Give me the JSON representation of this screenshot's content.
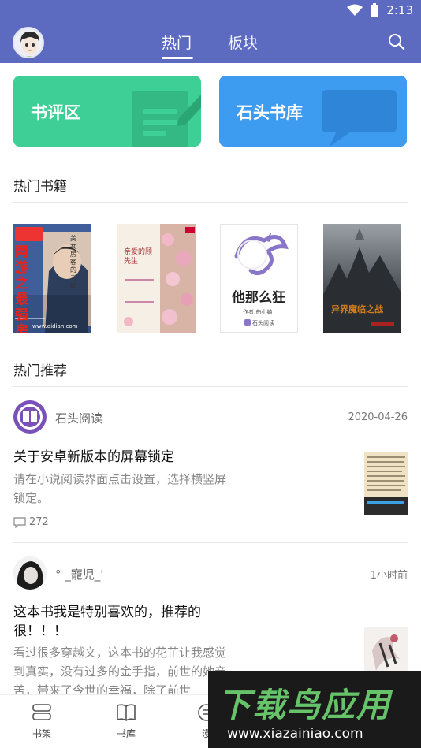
{
  "status_bar": {
    "time": "2:13"
  },
  "header": {
    "tabs": [
      {
        "label": "热门"
      },
      {
        "label": "板块"
      }
    ]
  },
  "cards": [
    {
      "label": "书评区"
    },
    {
      "label": "石头书库"
    }
  ],
  "hot_books": {
    "title": "热门书籍",
    "books": [
      {
        "cover_text": "网游之最强房东",
        "cover_sub": "美女房客的老妖",
        "site": "www.qidian.com"
      },
      {
        "cover_text": "亲爱的顾先生"
      },
      {
        "cover_text": "他那么狂",
        "author": "作者:曲小蛐",
        "brand": "石头阅读"
      },
      {
        "cover_text": "异界魔临之战"
      }
    ]
  },
  "recommend": {
    "title": "热门推荐",
    "posts": [
      {
        "author": "石头阅读",
        "time": "2020-04-26",
        "title": "关于安卓新版本的屏幕锁定",
        "excerpt_lines": [
          "请在小说阅读界面点击设置，选择横竖屏",
          "锁定。"
        ],
        "comments": "272"
      },
      {
        "author": "° _寵児_'",
        "time": "1小时前",
        "title_lines": [
          "这本书我是特别喜欢的，推荐的",
          "很！！！"
        ],
        "excerpt_lines": [
          "看过很多穿越文，这本书的花芷让我感觉",
          "到真实，没有过多的金手指，前世的她亲",
          "苦，带来了今世的幸福，除了前世"
        ]
      }
    ]
  },
  "bottom_nav": [
    {
      "label": "书架",
      "icon": "bookshelf-icon"
    },
    {
      "label": "书库",
      "icon": "book-icon"
    },
    {
      "label": "漫",
      "icon": "comic-icon"
    }
  ],
  "watermark": {
    "title": "下载鸟应用",
    "url": "www.xiazainiao.com"
  },
  "colors": {
    "primary": "#5c6bc0",
    "review_card": "#3ecf97",
    "library_card": "#3d9bf0"
  }
}
